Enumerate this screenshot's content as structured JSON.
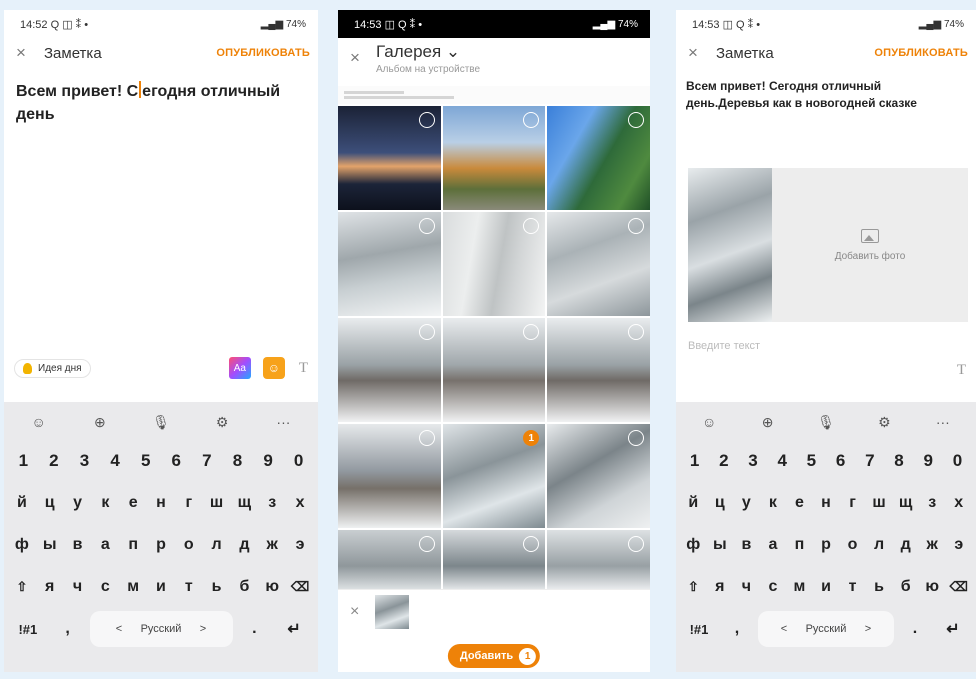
{
  "screen1": {
    "status": {
      "time": "14:52",
      "icons": "Q ◫ ⁑ •",
      "right": "74%"
    },
    "nav": {
      "close": "×",
      "title": "Заметка",
      "publish": "ОПУБЛИКОВАТЬ"
    },
    "note_before": "Всем привет! С",
    "note_after": "егодня отличный день",
    "idea_label": "Идея дня",
    "aa_label": "Aa",
    "t_label": "T"
  },
  "screen2": {
    "status": {
      "time": "14:53",
      "icons": "◫ Q ⁑ •",
      "right": "74%"
    },
    "close": "×",
    "title": "Галерея ⌄",
    "subtitle": "Альбом на устройстве",
    "selected_number": "1",
    "add_label": "Добавить",
    "add_count": "1"
  },
  "screen3": {
    "status": {
      "time": "14:53",
      "icons": "◫ Q ⁑ •",
      "right": "74%"
    },
    "nav": {
      "close": "×",
      "title": "Заметка",
      "publish": "ОПУБЛИКОВАТЬ"
    },
    "note": "Всем привет! Сегодня отличный день.Деревья как в новогодней сказке",
    "add_photo": "Добавить фото",
    "placeholder": "Введите текст",
    "t_label": "T"
  },
  "keyboard": {
    "top": [
      "☺",
      "⊕",
      "🎙",
      "⚙",
      "···"
    ],
    "numbers": [
      "1",
      "2",
      "3",
      "4",
      "5",
      "6",
      "7",
      "8",
      "9",
      "0"
    ],
    "row1": [
      "й",
      "ц",
      "у",
      "к",
      "е",
      "н",
      "г",
      "ш",
      "щ",
      "з",
      "х"
    ],
    "row2": [
      "ф",
      "ы",
      "в",
      "а",
      "п",
      "р",
      "о",
      "л",
      "д",
      "ж",
      "э"
    ],
    "row3": [
      "⇧",
      "я",
      "ч",
      "с",
      "м",
      "и",
      "т",
      "ь",
      "б",
      "ю",
      "⌫"
    ],
    "bottom": {
      "sym": "!#1",
      "comma": ",",
      "left": "<",
      "space": "Русский",
      "right": ">",
      "dot": ".",
      "enter": "↵"
    }
  },
  "toolbar_icons": [
    "photo-icon",
    "video-icon",
    "music-icon",
    "poll-icon",
    "more-icon",
    "settings-icon"
  ],
  "colors": {
    "accent": "#ee8208",
    "keyboard_bg": "#eaeaec",
    "page_bg": "#e6f1fa"
  }
}
